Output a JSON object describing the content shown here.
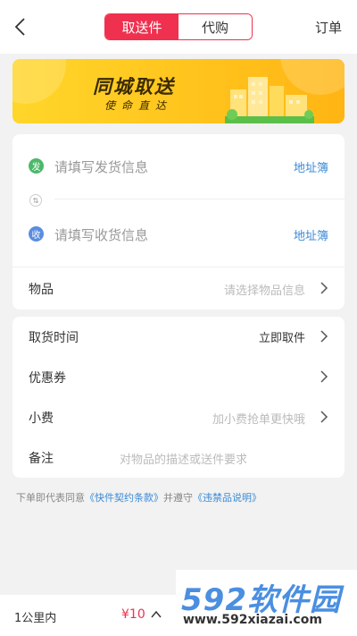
{
  "header": {
    "tabs": [
      {
        "label": "取送件",
        "active": true
      },
      {
        "label": "代购",
        "active": false
      }
    ],
    "orders_label": "订单",
    "accent_color": "#f0304f"
  },
  "banner": {
    "title": "同城取送",
    "subtitle": "使命直达"
  },
  "address": {
    "sender": {
      "badge": "发",
      "placeholder": "请填写发货信息",
      "link": "地址簿"
    },
    "receiver": {
      "badge": "收",
      "placeholder": "请填写收货信息",
      "link": "地址簿"
    },
    "swap_icon": "swap-icon"
  },
  "item": {
    "label": "物品",
    "placeholder": "请选择物品信息"
  },
  "details": {
    "pickup_time": {
      "label": "取货时间",
      "value": "立即取件"
    },
    "coupon": {
      "label": "优惠券"
    },
    "tip": {
      "label": "小费",
      "placeholder": "加小费抢单更快哦"
    },
    "note": {
      "label": "备注",
      "placeholder": "对物品的描述或送件要求"
    }
  },
  "agreement": {
    "prefix": "下单即代表同意",
    "link1": "《快件契约条款》",
    "middle": "并遵守",
    "link2": "《违禁品说明》"
  },
  "bottom": {
    "distance": "1公里内",
    "price": "¥10"
  },
  "watermark": {
    "number": "592",
    "name": "软件园",
    "url": "www.592xiazai.com"
  }
}
